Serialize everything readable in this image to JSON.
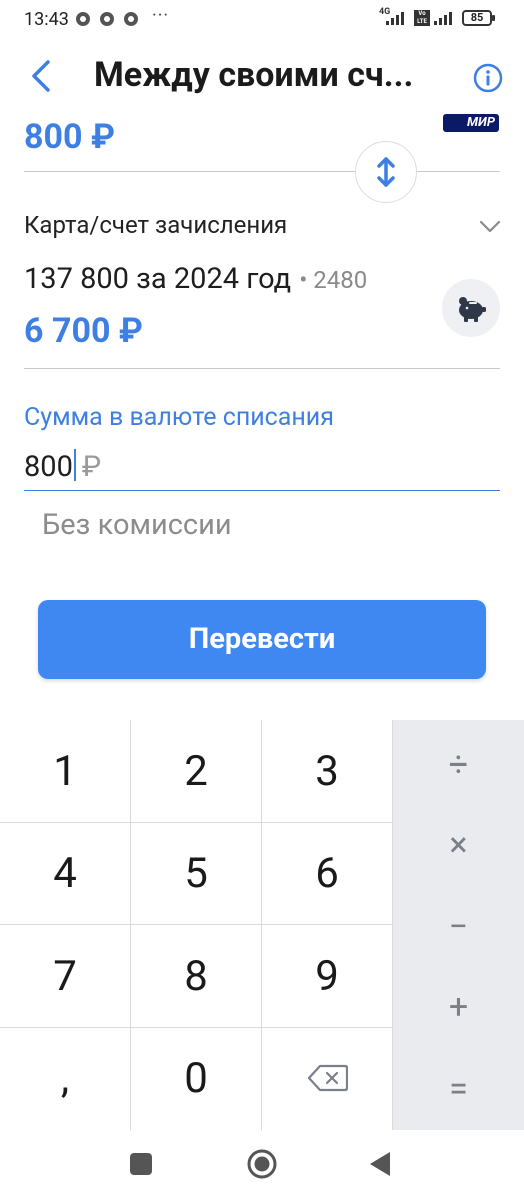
{
  "status": {
    "time": "13:43",
    "dots": "···",
    "net_1": "4G",
    "volte": "Vo LTE",
    "battery": "85"
  },
  "header": {
    "title": "Между своими сч...",
    "back_icon": "arrow-left-icon",
    "info_icon": "info-icon"
  },
  "source": {
    "amount": "800 ₽",
    "bank_logo": "МИР"
  },
  "destination": {
    "label": "Карта/счет зачисления",
    "name": "137 800 за 2024 год",
    "number": "• 2480",
    "amount": "6 700 ₽",
    "icon": "piggy-bank-icon"
  },
  "amount_input": {
    "label": "Сумма в валюте списания",
    "value": "800",
    "currency": "₽"
  },
  "commission": "Без комиссии",
  "transfer_button": "Перевести",
  "keypad": {
    "keys": [
      "1",
      "2",
      "3",
      "4",
      "5",
      "6",
      "7",
      "8",
      "9",
      ",",
      "0"
    ],
    "backspace_icon": "backspace-icon",
    "ops": [
      "÷",
      "×",
      "−",
      "+",
      "="
    ]
  },
  "colors": {
    "accent": "#3d7fe3",
    "button": "#3f88f2"
  }
}
